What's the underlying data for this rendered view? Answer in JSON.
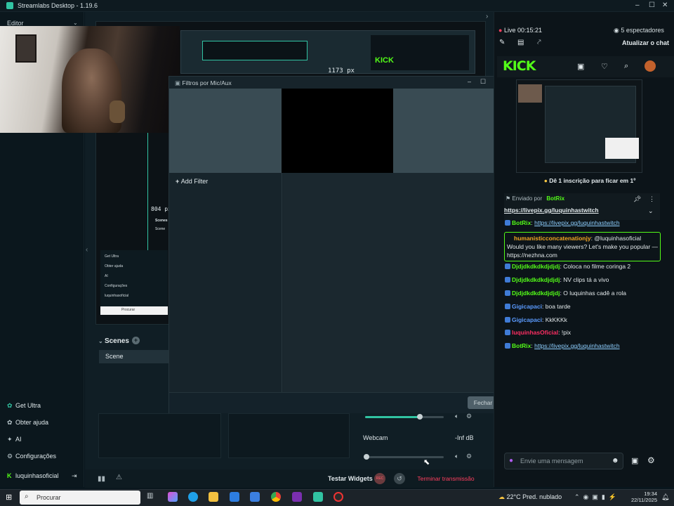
{
  "window": {
    "title": "Streamlabs Desktop - 1.19.6"
  },
  "editor": {
    "label": "Editor"
  },
  "nav": {
    "get_ultra": "Get Ultra",
    "help": "Obter ajuda",
    "ai": "AI",
    "settings": "Configurações",
    "user": "luquinhasoficial"
  },
  "preview": {
    "size_label_top": "1173 px",
    "size_label_left": "804 px"
  },
  "dialog": {
    "title": "Filtros por Mic/Aux",
    "add_filter": "Add Filter",
    "close_button": "Fechar"
  },
  "scenes": {
    "header": "Scenes",
    "items": [
      "Scene"
    ]
  },
  "mixer": {
    "source": "Webcam",
    "level": "-Inf dB",
    "slider1_level": 0.7,
    "slider2_level": 0.0
  },
  "bottombar": {
    "test_widgets": "Testar Widgets",
    "rec_label": "REC",
    "end_stream": "Terminar transmissão"
  },
  "chat": {
    "live_label": "Live 00:15:21",
    "viewers": "5 espectadores",
    "refresh_chat": "Atualizar o chat",
    "kick_logo": "KICK",
    "subscribe_prompt": "Dê 1 inscrição para ficar em 1º",
    "pinned_by": "Enviado por",
    "pinned_user": "BotRix",
    "pinned_link": "https://livepix.gg/luquinhastwitch",
    "messages": [
      {
        "user": "BotRix",
        "text": "https://livepix.gg/luquinhastwitch",
        "color": "#53fc18",
        "link": true
      },
      {
        "user": "humanisticconcatenationjy",
        "text": "@luquinhasoficial Would you like many viewers? Let's make you popular — https://nezhna.com",
        "color": "#f5a623",
        "link": false
      },
      {
        "user": "Djdjdkdkdkdjdjdj",
        "text": "Coloca no filme coringa 2",
        "color": "#53fc18",
        "link": false
      },
      {
        "user": "Djdjdkdkdkdjdjdj",
        "text": "NV clips tá a vivo",
        "color": "#53fc18",
        "link": false
      },
      {
        "user": "Djdjdkdkdkdjdjdj",
        "text": "O luquinhas cadê a rola",
        "color": "#53fc18",
        "link": false
      },
      {
        "user": "Gigicapaci",
        "text": "boa tarde",
        "color": "#5b9bff",
        "link": false
      },
      {
        "user": "Gigicapaci",
        "text": "KkKKKk",
        "color": "#5b9bff",
        "link": false
      },
      {
        "user": "luquinhasOficial",
        "text": "!pix",
        "color": "#ff2e63",
        "link": false
      },
      {
        "user": "BotRix",
        "text": "https://livepix.gg/luquinhastwitch",
        "color": "#53fc18",
        "link": true
      }
    ],
    "input_placeholder": "Envie uma mensagem"
  },
  "taskbar": {
    "search_placeholder": "Procurar",
    "weather": "22°C  Pred. nublado",
    "time": "19:34",
    "date": "22/11/2025"
  },
  "colors": {
    "accent": "#31c3a2",
    "kick_green": "#53fc18",
    "end_stream": "#ff3f5f"
  }
}
